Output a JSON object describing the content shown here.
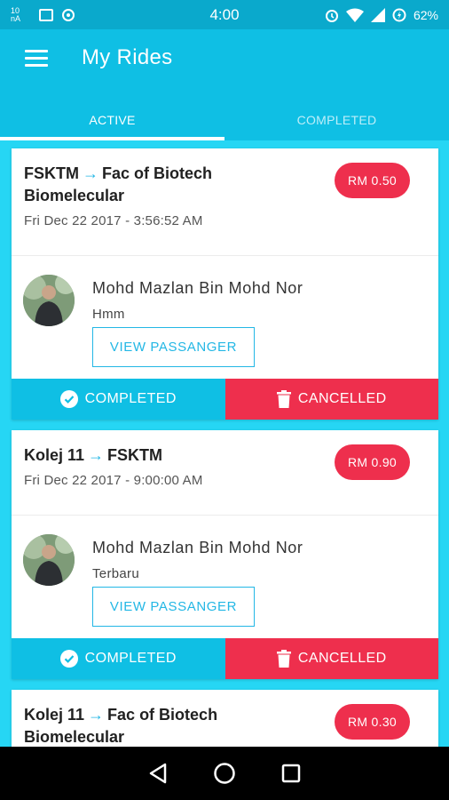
{
  "status_bar": {
    "small_text": "10 nA",
    "time": "4:00",
    "battery": "62%"
  },
  "app": {
    "title": "My Rides"
  },
  "tabs": [
    {
      "label": "ACTIVE",
      "active": true
    },
    {
      "label": "COMPLETED",
      "active": false
    }
  ],
  "rides": [
    {
      "from": "FSKTM",
      "to": "Fac of Biotech Biomelecular",
      "date": "Fri Dec 22 2017 - 3:56:52 AM",
      "price": "RM 0.50",
      "driver_name": "Mohd Mazlan Bin Mohd Nor",
      "note": "Hmm",
      "view_label": "VIEW PASSANGER",
      "completed_label": "COMPLETED",
      "cancelled_label": "CANCELLED"
    },
    {
      "from": "Kolej 11",
      "to": "FSKTM",
      "date": "Fri Dec 22 2017 - 9:00:00 AM",
      "price": "RM 0.90",
      "driver_name": "Mohd Mazlan Bin Mohd Nor",
      "note": "Terbaru",
      "view_label": "VIEW PASSANGER",
      "completed_label": "COMPLETED",
      "cancelled_label": "CANCELLED"
    },
    {
      "from": "Kolej 11",
      "to": "Fac of Biotech Biomelecular",
      "price": "RM 0.30"
    }
  ],
  "colors": {
    "primary": "#0fbfe4",
    "status_bar": "#0aa9cc",
    "accent_red": "#ee2f4d",
    "background": "#26d6f4"
  },
  "icons": {
    "menu": "menu-icon",
    "arrow": "arrow-right-icon",
    "completed": "check-circle-icon",
    "cancelled": "trash-icon",
    "nav_back": "back-triangle-icon",
    "nav_home": "home-circle-icon",
    "nav_recents": "recents-square-icon"
  }
}
